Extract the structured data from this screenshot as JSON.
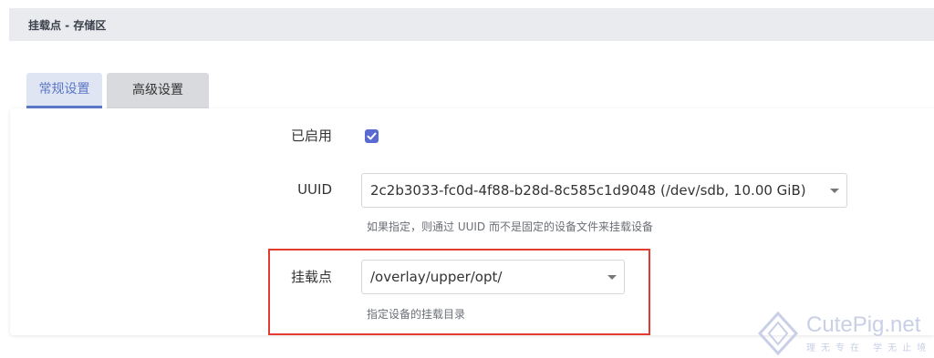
{
  "header": {
    "title": "挂载点 - 存储区"
  },
  "tabs": [
    {
      "label": "常规设置",
      "active": true
    },
    {
      "label": "高级设置",
      "active": false
    }
  ],
  "form": {
    "enabled": {
      "label": "已启用",
      "checked": true
    },
    "uuid": {
      "label": "UUID",
      "value": "2c2b3033-fc0d-4f88-b28d-8c585c1d9048 (/dev/sdb, 10.00 GiB)",
      "help": "如果指定，则通过 UUID 而不是固定的设备文件来挂载设备"
    },
    "mount": {
      "label": "挂载点",
      "value": "/overlay/upper/opt/",
      "help": "指定设备的挂载目录"
    }
  },
  "watermark": {
    "text": "CutePig.net",
    "sub": "理无专在 学无止境"
  },
  "colors": {
    "accent": "#5b6ad0",
    "highlight_border": "#e33b2f",
    "tab_active_bg": "#dfe5f3"
  }
}
